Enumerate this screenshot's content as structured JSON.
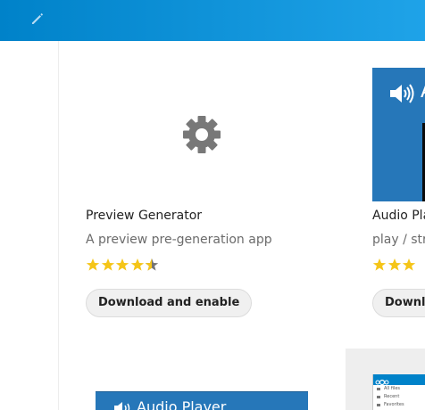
{
  "header": {
    "edit_icon": "pencil-icon",
    "accent_color": "#0082c9"
  },
  "apps": [
    {
      "icon": "gear-icon",
      "title": "Preview Generator",
      "description": "A preview pre-generation app",
      "rating": 4.5,
      "rating_max": 5,
      "button_label": "Download and enable"
    },
    {
      "icon": "speaker-icon",
      "title_visible": "Audio Pla",
      "description_visible": "play / stre",
      "rating": 3,
      "button_label_visible": "Downlo"
    }
  ],
  "screenshots": {
    "audio_player_title": "Audio Player",
    "mini_app_rows": [
      "All files",
      "Recent",
      "Favorites"
    ]
  },
  "colors": {
    "star": "#f5c518",
    "star_empty": "#757575",
    "button_bg": "#f0f0f0"
  }
}
